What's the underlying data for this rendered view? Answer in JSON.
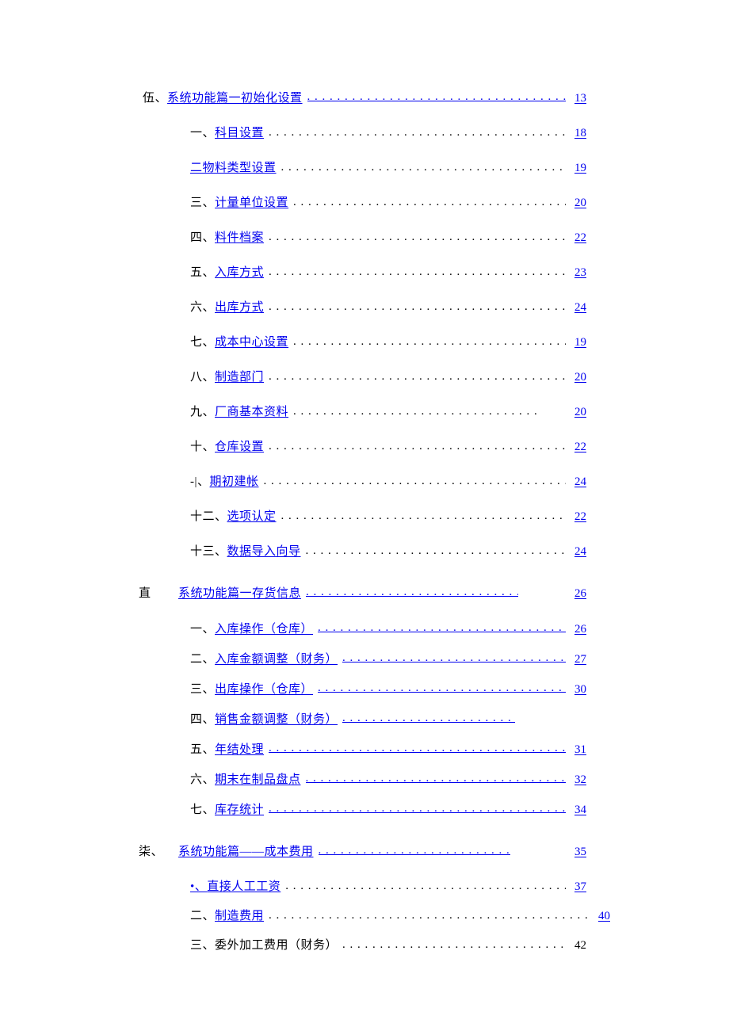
{
  "sections": [
    {
      "mark": "伍、",
      "title": "系统功能篇一初始化设置",
      "page": "13",
      "linked": true,
      "dotsLinked": true,
      "items": [
        {
          "num": "一、",
          "title": "科目设置",
          "page": "18",
          "linked": true
        },
        {
          "num": "二",
          "title": "物料类型设置",
          "page": "19",
          "linked": true,
          "nospace": true
        },
        {
          "num": "三、",
          "title": "计量单位设置",
          "page": "20",
          "linked": true
        },
        {
          "num": "四、",
          "title": "料件档案",
          "page": "22",
          "linked": true
        },
        {
          "num": "五、",
          "title": "入库方式",
          "page": "23",
          "linked": true
        },
        {
          "num": "六、",
          "title": "出库方式",
          "page": "24",
          "linked": true
        },
        {
          "num": "七、",
          "title": "成本中心设置",
          "page": "19",
          "linked": true
        },
        {
          "num": "八、",
          "title": "制造部门",
          "page": "20",
          "linked": true
        },
        {
          "num": "九、",
          "title": "厂商基本资料",
          "page": "20",
          "linked": true,
          "shorten": 30
        },
        {
          "num": "十、",
          "title": "仓库设置",
          "page": "22",
          "linked": true
        },
        {
          "num": "-|、",
          "title": "期初建帐",
          "page": "24",
          "linked": true
        },
        {
          "num": "十二、",
          "title": "选项认定",
          "page": "22",
          "linked": true
        },
        {
          "num": "十三、",
          "title": "数据导入向导",
          "page": "24",
          "linked": true
        }
      ]
    },
    {
      "mark": "直",
      "title": "系统功能篇一存货信息",
      "page": "26",
      "linked": true,
      "dotsLinked": true,
      "indent": true,
      "shorten": 60,
      "items": [
        {
          "num": "一、",
          "title": "入库操作（仓库）",
          "page": "26",
          "linked": true,
          "dotsLinked": true
        },
        {
          "num": "二、",
          "title": "入库金额调整（财务）",
          "page": "27",
          "linked": true,
          "dotsLinked": true
        },
        {
          "num": "三、",
          "title": "出库操作（仓库）",
          "page": "30",
          "linked": true,
          "dotsLinked": true
        },
        {
          "num": "四、",
          "title": "销售金额调整（财务）",
          "page": "",
          "linked": true,
          "dotsLinked": true,
          "shorten": 90
        },
        {
          "num": "五、",
          "title": "年结处理",
          "page": "31",
          "linked": true,
          "dotsLinked": true
        },
        {
          "num": "六、",
          "title": "期末在制品盘点",
          "page": "32",
          "linked": true,
          "dotsLinked": true
        },
        {
          "num": "七、",
          "title": "库存统计",
          "page": "34",
          "linked": true,
          "dotsLinked": true
        }
      ]
    },
    {
      "mark": "柒、",
      "title": "系统功能篇——成本费用",
      "page": "35",
      "linked": true,
      "dotsLinked": true,
      "indent": true,
      "shorten": 70,
      "items": [
        {
          "num": "•、",
          "title": "直接人工工资",
          "page": "37",
          "linked": true
        },
        {
          "num": "二、",
          "title": "制造费用",
          "page": "40",
          "linked": true,
          "wider": true
        },
        {
          "num": "三、",
          "title": "委外加工费用（财务）",
          "page": "42",
          "linked": false
        }
      ]
    }
  ]
}
